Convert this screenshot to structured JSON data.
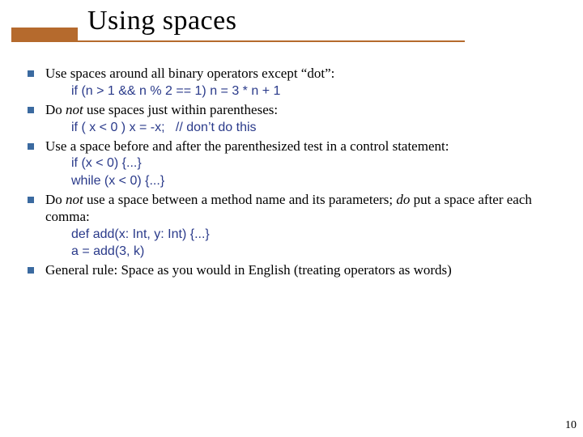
{
  "slide": {
    "title": "Using spaces",
    "number": "10"
  },
  "bullets": [
    {
      "text_pre": "Use spaces around all binary operators except “dot”:",
      "code": [
        "if (n > 1 && n % 2 == 1) n = 3 * n + 1"
      ]
    },
    {
      "text_pre_html": "Do <em>not</em> use spaces just within parentheses:",
      "code": [
        "if ( x < 0 ) x = -x;   // don’t do this"
      ]
    },
    {
      "text_pre": "Use a space before and after the parenthesized test in a control statement:",
      "code": [
        "if (x < 0) {...}",
        "while (x < 0) {...}"
      ]
    },
    {
      "text_pre_html": "Do <em>not</em> use a space between a method name and its parameters; <em>do</em> put a space after each comma:",
      "code": [
        "def add(x: Int, y: Int) {...}",
        "a = add(3, k)"
      ]
    },
    {
      "text_pre": "General rule: Space as you would in English (treating operators as words)",
      "code": []
    }
  ]
}
